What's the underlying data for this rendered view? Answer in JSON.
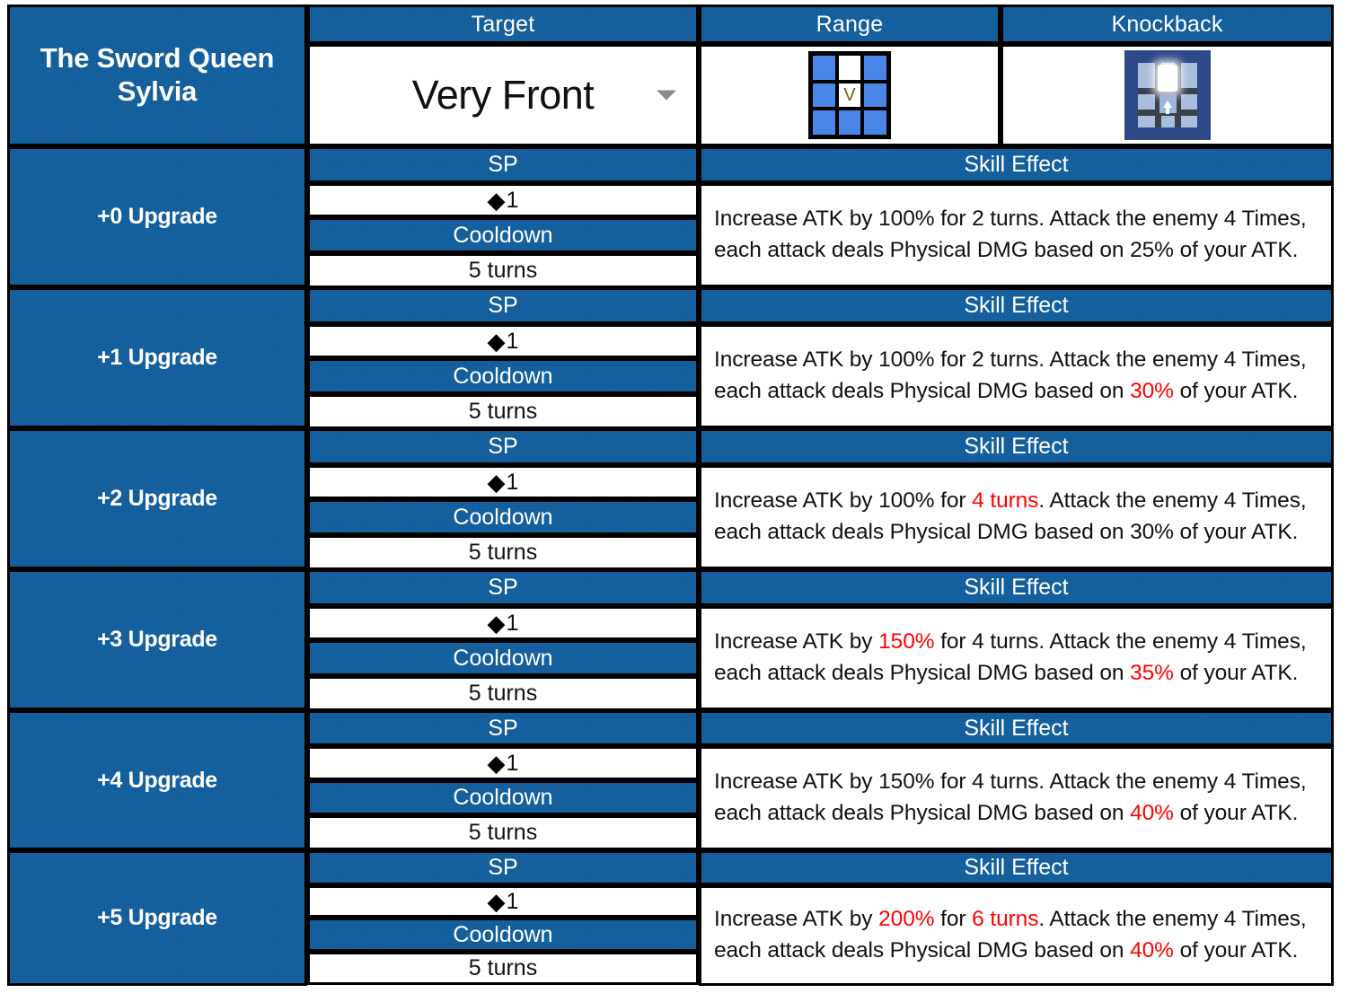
{
  "colors": {
    "header_blue": "#15609E",
    "highlight_red": "#FF0000",
    "range_cell_blue": "#4A86E8",
    "knockback_bg": "#2F4B8C"
  },
  "header": {
    "unit_name": "The Sword Queen\nSylvia",
    "unit_name_line1": "The Sword Queen",
    "unit_name_line2": "Sylvia",
    "columns": {
      "target": "Target",
      "range": "Range",
      "knockback": "Knockback"
    },
    "target_value": "Very Front",
    "target_caret_icon": "chevron-down-icon",
    "range_icon": {
      "name": "range-grid-icon",
      "self_marker": "V",
      "cells": [
        "blue",
        "empty",
        "blue",
        "blue",
        "self",
        "blue",
        "blue",
        "blue",
        "blue"
      ]
    },
    "knockback_icon": {
      "name": "knockback-icon",
      "arrow": "arrow-up-icon"
    }
  },
  "labels": {
    "sp": "SP",
    "cooldown": "Cooldown",
    "skill_effect": "Skill Effect",
    "sp_diamond": "◆"
  },
  "rows": [
    {
      "upgrade": "+0 Upgrade",
      "sp": "1",
      "cooldown": "5 turns",
      "effect_parts": [
        {
          "text": "Increase ATK by 100% for 2 turns. Attack the enemy 4 Times, each attack deals Physical DMG based on ",
          "red": false
        },
        {
          "text": "25%",
          "red": false
        },
        {
          "text": " of your ATK.",
          "red": false
        }
      ]
    },
    {
      "upgrade": "+1 Upgrade",
      "sp": "1",
      "cooldown": "5 turns",
      "effect_parts": [
        {
          "text": "Increase ATK by 100% for 2 turns. Attack the enemy 4 Times, each attack deals Physical DMG based on ",
          "red": false
        },
        {
          "text": "30%",
          "red": true
        },
        {
          "text": " of your ATK.",
          "red": false
        }
      ]
    },
    {
      "upgrade": "+2 Upgrade",
      "sp": "1",
      "cooldown": "5 turns",
      "effect_parts": [
        {
          "text": "Increase ATK by 100% for ",
          "red": false
        },
        {
          "text": "4 turns",
          "red": true
        },
        {
          "text": ". Attack the enemy 4 Times, each attack deals Physical DMG based on 30% of your ATK.",
          "red": false
        }
      ]
    },
    {
      "upgrade": "+3 Upgrade",
      "sp": "1",
      "cooldown": "5 turns",
      "effect_parts": [
        {
          "text": "Increase ATK by ",
          "red": false
        },
        {
          "text": "150%",
          "red": true
        },
        {
          "text": " for 4 turns. Attack the enemy 4 Times, each attack deals Physical DMG based on ",
          "red": false
        },
        {
          "text": "35%",
          "red": true
        },
        {
          "text": " of your ATK.",
          "red": false
        }
      ]
    },
    {
      "upgrade": "+4 Upgrade",
      "sp": "1",
      "cooldown": "5 turns",
      "effect_parts": [
        {
          "text": "Increase ATK by 150% for 4 turns. Attack the enemy 4 Times, each attack deals Physical DMG based on ",
          "red": false
        },
        {
          "text": "40%",
          "red": true
        },
        {
          "text": " of your ATK.",
          "red": false
        }
      ]
    },
    {
      "upgrade": "+5 Upgrade",
      "sp": "1",
      "cooldown": "5 turns",
      "effect_parts": [
        {
          "text": "Increase ATK by ",
          "red": false
        },
        {
          "text": "200%",
          "red": true
        },
        {
          "text": " for ",
          "red": false
        },
        {
          "text": "6 turns",
          "red": true
        },
        {
          "text": ". Attack the enemy 4 Times, each attack deals Physical DMG based on ",
          "red": false
        },
        {
          "text": "40%",
          "red": true
        },
        {
          "text": " of your ATK.",
          "red": false
        }
      ]
    }
  ]
}
